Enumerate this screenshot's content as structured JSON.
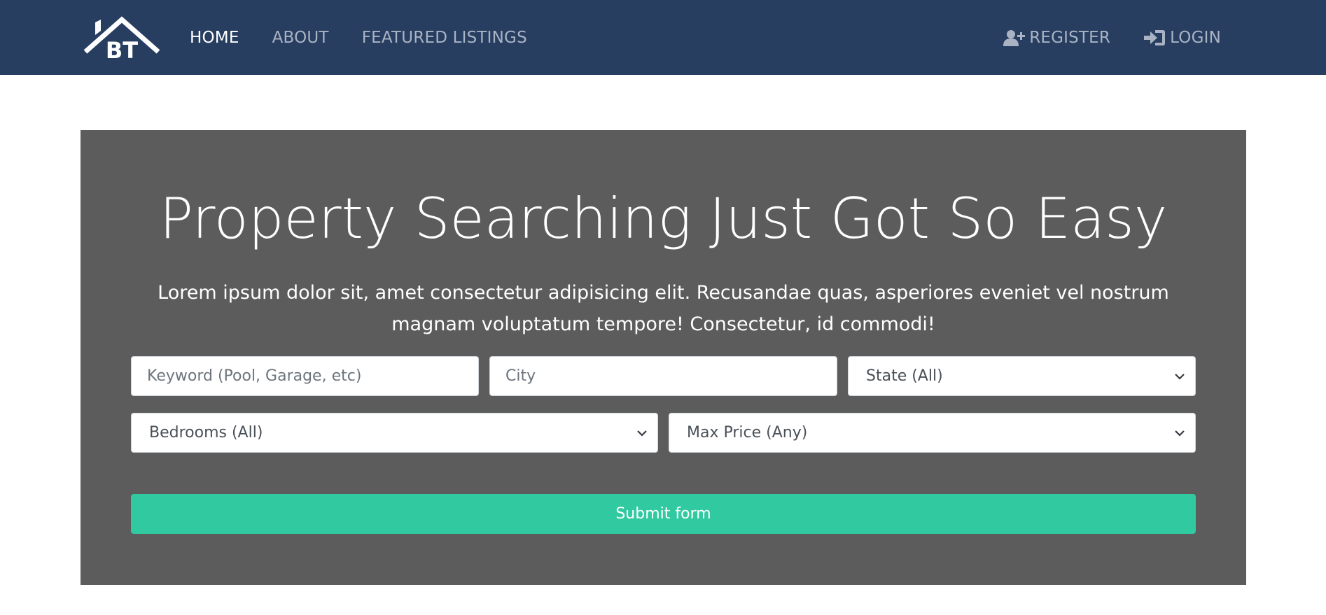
{
  "brand": {
    "logo_text": "BT",
    "logo_icon": "house-roof-icon"
  },
  "nav": {
    "left": [
      {
        "label": "HOME",
        "active": true
      },
      {
        "label": "ABOUT",
        "active": false
      },
      {
        "label": "FEATURED LISTINGS",
        "active": false
      }
    ],
    "right": [
      {
        "label": "REGISTER",
        "icon": "user-plus-icon"
      },
      {
        "label": "LOGIN",
        "icon": "sign-in-icon"
      }
    ]
  },
  "hero": {
    "title": "Property Searching Just Got So Easy",
    "lead": "Lorem ipsum dolor sit, amet consectetur adipisicing elit. Recusandae quas, asperiores eveniet vel nostrum magnam voluptatum tempore! Consectetur, id commodi!"
  },
  "search": {
    "keyword_placeholder": "Keyword (Pool, Garage, etc)",
    "city_placeholder": "City",
    "state_selected": "State (All)",
    "bedrooms_selected": "Bedrooms (All)",
    "max_price_selected": "Max Price (Any)",
    "submit_label": "Submit form"
  },
  "colors": {
    "navbar_bg": "#283e61",
    "hero_bg": "#5c5c5c",
    "submit_bg": "#30c9a0",
    "nav_link": "#a9b3c3",
    "nav_active": "#ffffff"
  }
}
